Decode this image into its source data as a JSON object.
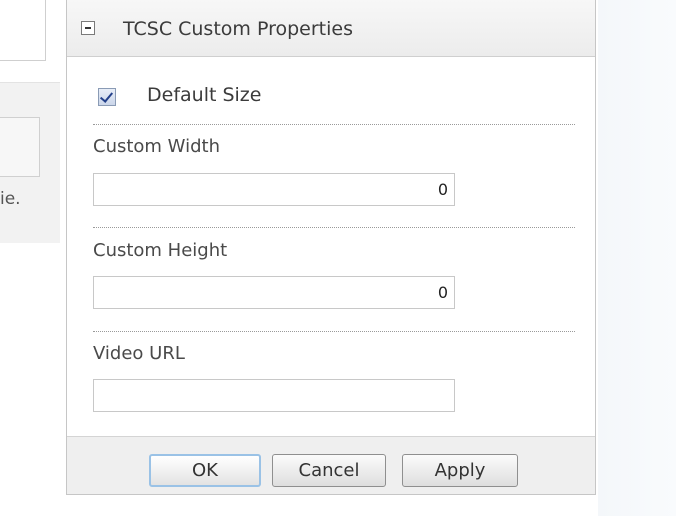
{
  "background": {
    "left_fragment": "ie."
  },
  "panel": {
    "title": "TCSC Custom Properties",
    "default_size": {
      "label": "Default Size",
      "checked": true
    },
    "custom_width": {
      "label": "Custom Width",
      "value": "0"
    },
    "custom_height": {
      "label": "Custom Height",
      "value": "0"
    },
    "video_url": {
      "label": "Video URL",
      "value": ""
    },
    "buttons": {
      "ok": "OK",
      "cancel": "Cancel",
      "apply": "Apply"
    }
  },
  "colors": {
    "panel_border": "#c6c6c6",
    "ok_focus_border": "#9ac2e6",
    "checkbox_check": "#24418b"
  },
  "icons": {
    "collapse": "minus-box-icon",
    "checkbox": "checked-checkbox-icon"
  }
}
